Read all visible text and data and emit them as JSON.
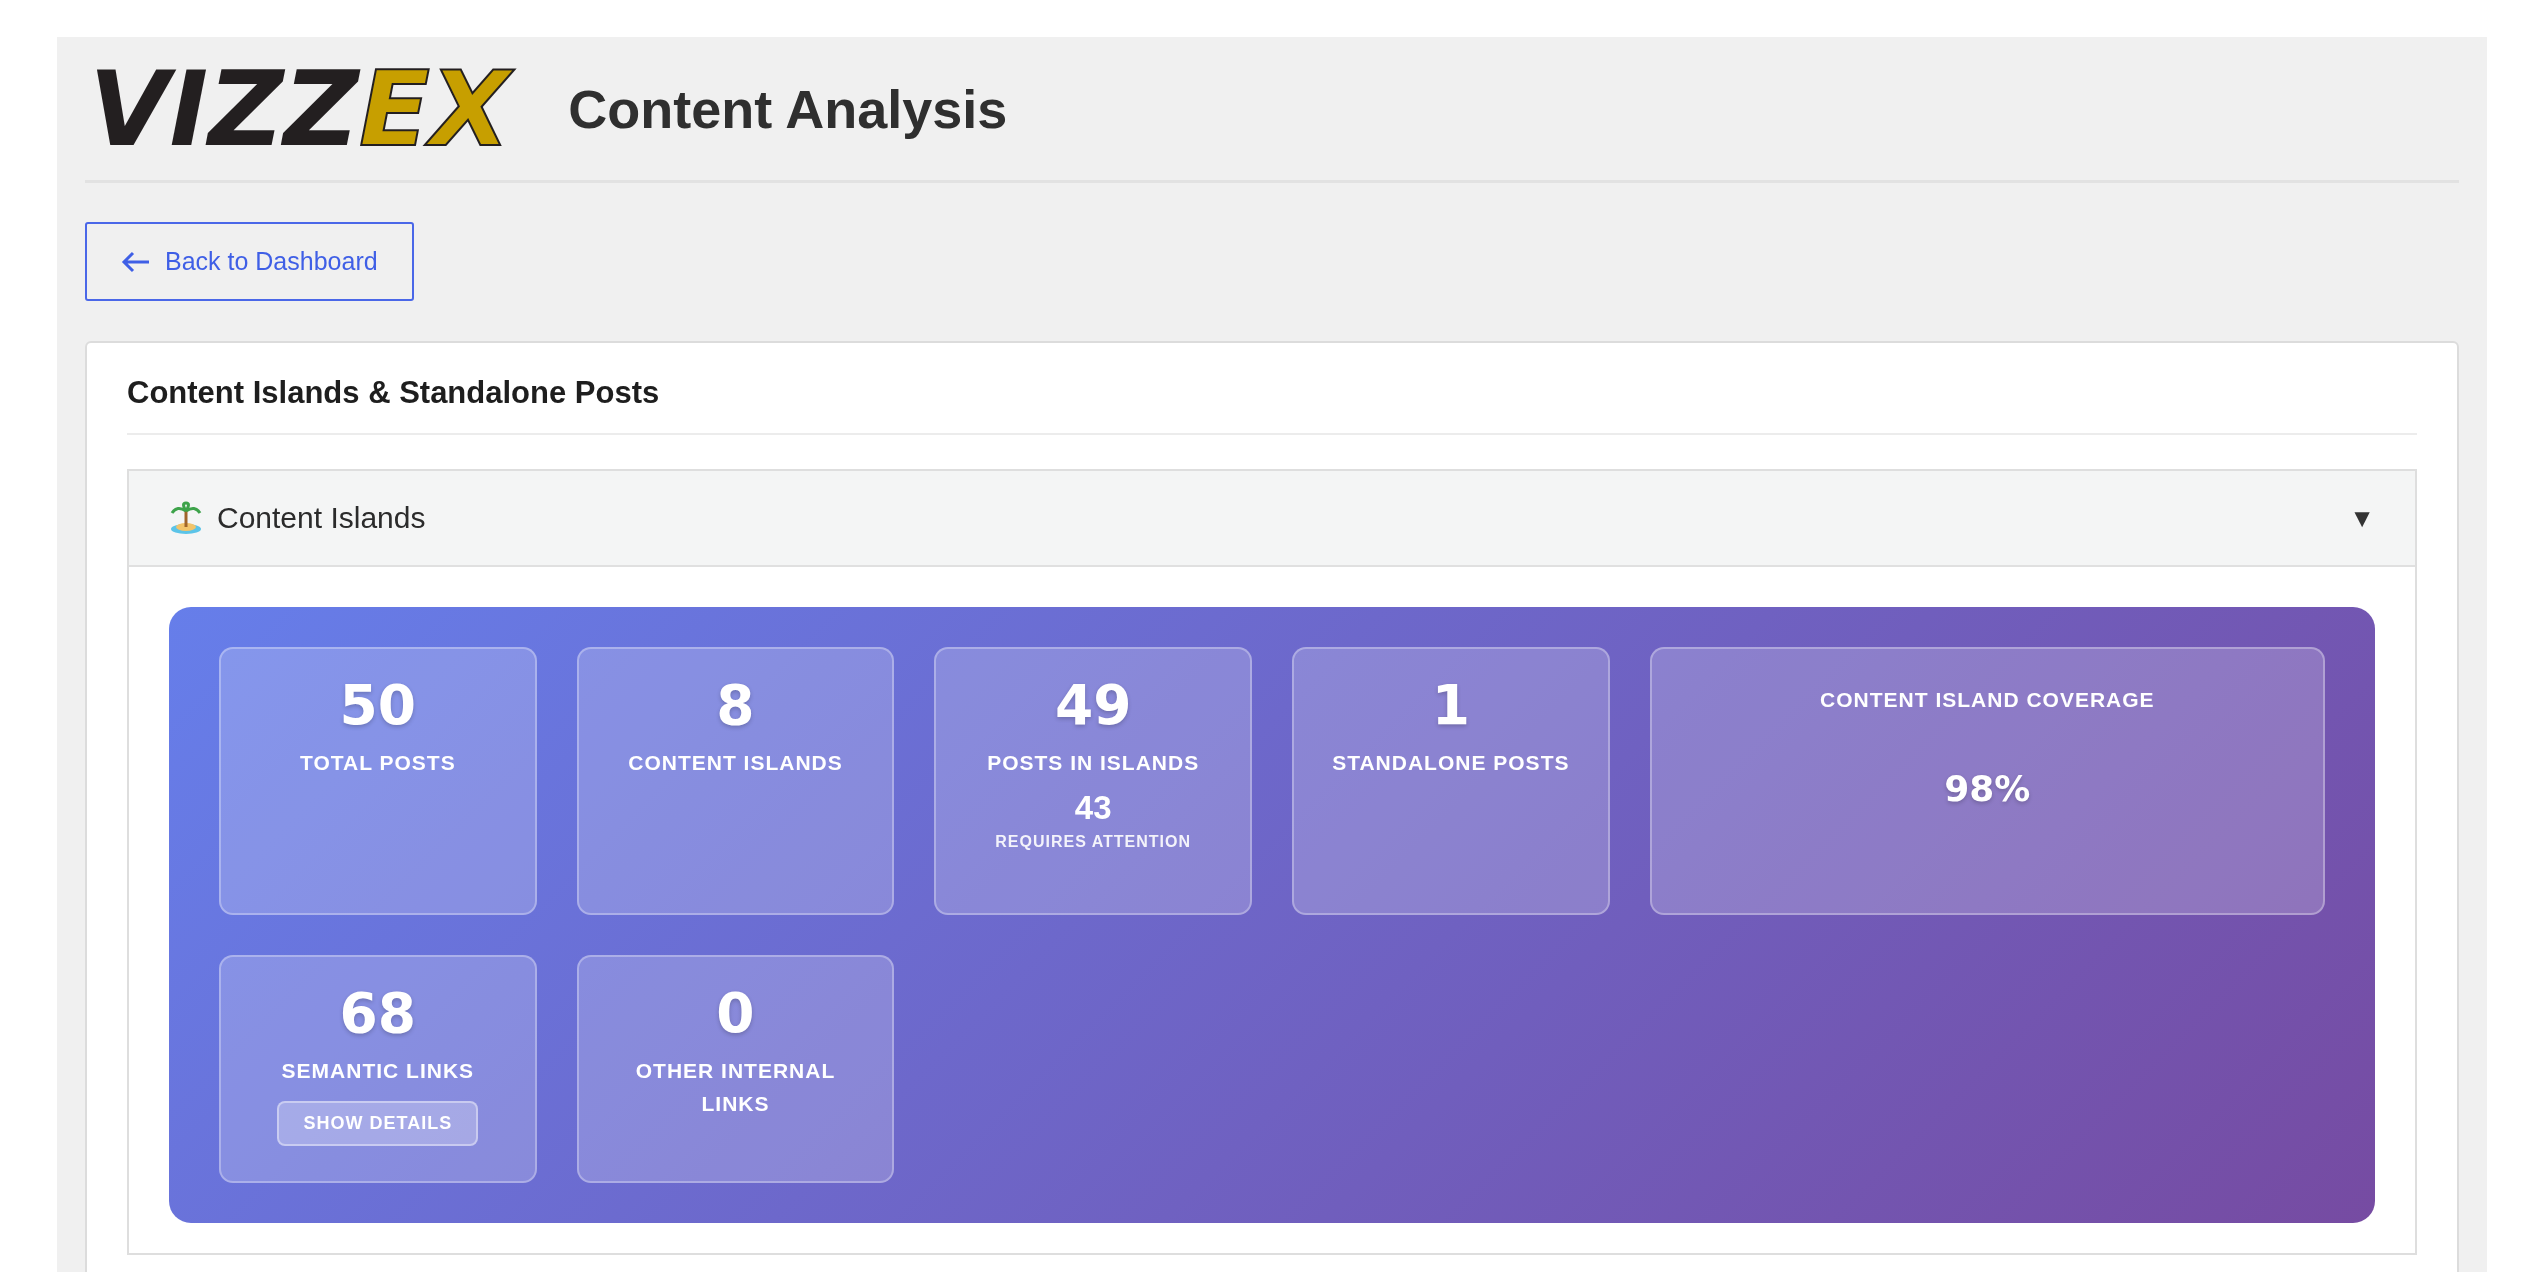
{
  "header": {
    "logo": {
      "dark": "VIZZ",
      "accent": "EX"
    },
    "title": "Content Analysis"
  },
  "back_button": {
    "label": "Back to Dashboard"
  },
  "card": {
    "title": "Content Islands & Standalone Posts"
  },
  "accordion": {
    "title": "Content Islands",
    "toggle": "▼",
    "expanded": true
  },
  "stats": [
    {
      "kind": "stat",
      "value": "50",
      "label": "TOTAL POSTS"
    },
    {
      "kind": "stat",
      "value": "8",
      "label": "CONTENT ISLANDS"
    },
    {
      "kind": "stat",
      "value": "49",
      "label": "POSTS IN ISLANDS",
      "sub_value": "43",
      "sub_label": "REQUIRES ATTENTION"
    },
    {
      "kind": "stat",
      "value": "1",
      "label": "STANDALONE POSTS"
    },
    {
      "kind": "coverage",
      "value": "98%",
      "label": "CONTENT ISLAND COVERAGE"
    },
    {
      "kind": "stat",
      "value": "68",
      "label": "SEMANTIC LINKS",
      "button": "SHOW DETAILS"
    },
    {
      "kind": "stat",
      "value": "0",
      "label": "OTHER INTERNAL LINKS"
    }
  ]
}
